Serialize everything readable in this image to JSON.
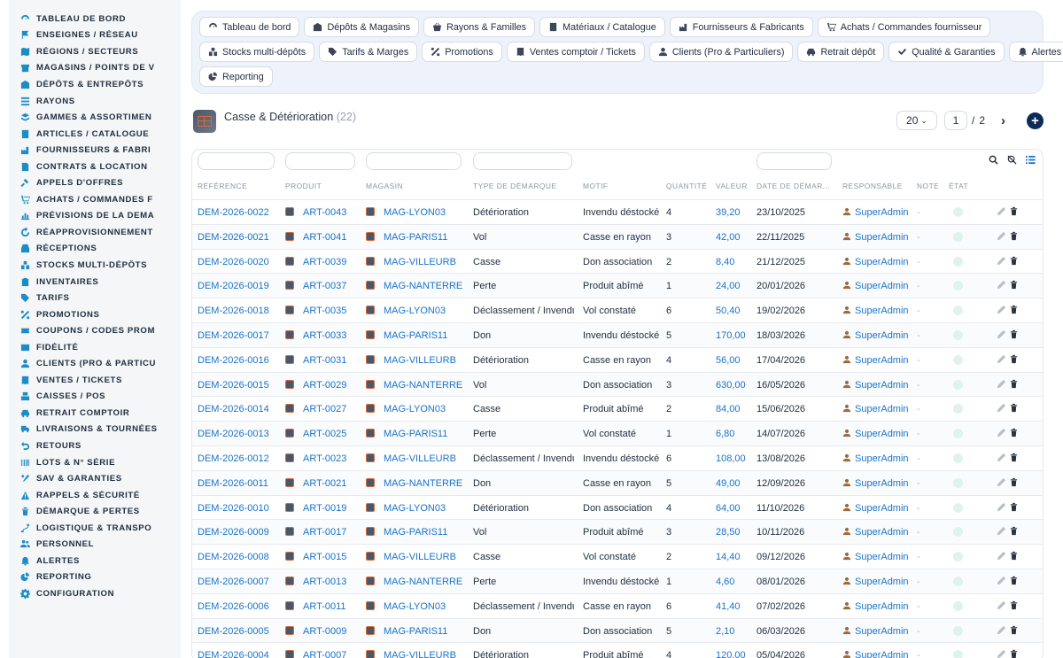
{
  "sidebar": {
    "items": [
      {
        "label": "TABLEAU DE BORD",
        "icon": "dashboard-icon"
      },
      {
        "label": "ENSEIGNES / RÉSEAU",
        "icon": "flag-icon"
      },
      {
        "label": "RÉGIONS / SECTEURS",
        "icon": "map-icon"
      },
      {
        "label": "MAGASINS / POINTS DE V",
        "icon": "store-icon"
      },
      {
        "label": "DÉPÔTS & ENTREPÔTS",
        "icon": "warehouse-icon"
      },
      {
        "label": "RAYONS",
        "icon": "shelf-icon"
      },
      {
        "label": "GAMMES & ASSORTIMEN",
        "icon": "layers-icon"
      },
      {
        "label": "ARTICLES / CATALOGUE",
        "icon": "catalog-icon"
      },
      {
        "label": "FOURNISSEURS & FABRI",
        "icon": "factory-icon"
      },
      {
        "label": "CONTRATS & LOCATION",
        "icon": "document-icon"
      },
      {
        "label": "APPELS D'OFFRES",
        "icon": "gavel-icon"
      },
      {
        "label": "ACHATS / COMMANDES F",
        "icon": "cart-icon"
      },
      {
        "label": "PRÉVISIONS DE LA DEMA",
        "icon": "chart-icon"
      },
      {
        "label": "RÉAPPROVISIONNEMENT",
        "icon": "refresh-icon"
      },
      {
        "label": "RÉCEPTIONS",
        "icon": "inbox-icon"
      },
      {
        "label": "STOCKS MULTI-DÉPÔTS",
        "icon": "boxes-icon"
      },
      {
        "label": "INVENTAIRES",
        "icon": "clipboard-icon"
      },
      {
        "label": "TARIFS",
        "icon": "tag-icon"
      },
      {
        "label": "PROMOTIONS",
        "icon": "percent-icon"
      },
      {
        "label": "COUPONS / CODES PROM",
        "icon": "ticket-icon"
      },
      {
        "label": "FIDÉLITÉ",
        "icon": "card-icon"
      },
      {
        "label": "CLIENTS (PRO & PARTICU",
        "icon": "user-icon"
      },
      {
        "label": "VENTES / TICKETS",
        "icon": "receipt-icon"
      },
      {
        "label": "CAISSES / POS",
        "icon": "register-icon"
      },
      {
        "label": "RETRAIT COMPTOIR",
        "icon": "car-icon"
      },
      {
        "label": "LIVRAISONS & TOURNÉES",
        "icon": "truck-icon"
      },
      {
        "label": "RETOURS",
        "icon": "undo-icon"
      },
      {
        "label": "LOTS & N° SÉRIE",
        "icon": "barcode-icon"
      },
      {
        "label": "SAV & GARANTIES",
        "icon": "tools-icon"
      },
      {
        "label": "RAPPELS & SÉCURITÉ",
        "icon": "warning-icon"
      },
      {
        "label": "DÉMARQUE & PERTES",
        "icon": "trash-icon"
      },
      {
        "label": "LOGISTIQUE & TRANSPO",
        "icon": "route-icon"
      },
      {
        "label": "PERSONNEL",
        "icon": "people-icon"
      },
      {
        "label": "ALERTES",
        "icon": "bell-icon"
      },
      {
        "label": "REPORTING",
        "icon": "pie-icon"
      },
      {
        "label": "CONFIGURATION",
        "icon": "gear-icon"
      }
    ]
  },
  "modules": {
    "rows": [
      [
        {
          "label": "Tableau de bord",
          "icon": "dashboard-icon"
        },
        {
          "label": "Dépôts & Magasins",
          "icon": "warehouse-icon"
        },
        {
          "label": "Rayons & Familles",
          "icon": "basket-icon"
        },
        {
          "label": "Matériaux / Catalogue",
          "icon": "catalog-icon"
        },
        {
          "label": "Fournisseurs & Fabricants",
          "icon": "factory-icon"
        },
        {
          "label": "Achats / Commandes fournisseur",
          "icon": "cart-icon"
        }
      ],
      [
        {
          "label": "Stocks multi-dépôts",
          "icon": "boxes-icon"
        },
        {
          "label": "Tarifs & Marges",
          "icon": "tag-icon"
        },
        {
          "label": "Promotions",
          "icon": "percent-icon"
        },
        {
          "label": "Ventes comptoir / Tickets",
          "icon": "receipt-icon"
        },
        {
          "label": "Clients (Pro & Particuliers)",
          "icon": "user-icon"
        },
        {
          "label": "Retrait dépôt",
          "icon": "car-icon"
        },
        {
          "label": "Qualité & Garanties",
          "icon": "check-icon"
        },
        {
          "label": "Alertes",
          "icon": "bell-icon"
        }
      ],
      [
        {
          "label": "Reporting",
          "icon": "pie-icon"
        }
      ]
    ]
  },
  "header": {
    "title": "Casse & Détérioration",
    "count": "(22)",
    "page_size": "20",
    "page_current": "1",
    "page_separator": "/",
    "page_total": "2",
    "next_symbol": "›",
    "add_symbol": "+"
  },
  "table": {
    "columns": [
      "RÉFÉRENCE",
      "PRODUIT",
      "MAGASIN",
      "TYPE DE DÉMARQUE",
      "MOTIF",
      "QUANTITÉ",
      "VALEUR",
      "DATE DE DÉMAR...",
      "RESPONSABLE",
      "NOTE",
      "ÉTAT"
    ],
    "rows": [
      [
        "DEM-2026-0022",
        "ART-0043",
        "MAG-LYON03",
        "Détérioration",
        "Invendu déstocké",
        "4",
        "39,20",
        "23/10/2025",
        "SuperAdmin",
        "-"
      ],
      [
        "DEM-2026-0021",
        "ART-0041",
        "MAG-PARIS11",
        "Vol",
        "Casse en rayon",
        "3",
        "42,00",
        "22/11/2025",
        "SuperAdmin",
        "-"
      ],
      [
        "DEM-2026-0020",
        "ART-0039",
        "MAG-VILLEURB",
        "Casse",
        "Don association",
        "2",
        "8,40",
        "21/12/2025",
        "SuperAdmin",
        "-"
      ],
      [
        "DEM-2026-0019",
        "ART-0037",
        "MAG-NANTERRE",
        "Perte",
        "Produit abîmé",
        "1",
        "24,00",
        "20/01/2026",
        "SuperAdmin",
        "-"
      ],
      [
        "DEM-2026-0018",
        "ART-0035",
        "MAG-LYON03",
        "Déclassement / Invendu",
        "Vol constaté",
        "6",
        "50,40",
        "19/02/2026",
        "SuperAdmin",
        "-"
      ],
      [
        "DEM-2026-0017",
        "ART-0033",
        "MAG-PARIS11",
        "Don",
        "Invendu déstocké",
        "5",
        "170,00",
        "18/03/2026",
        "SuperAdmin",
        "-"
      ],
      [
        "DEM-2026-0016",
        "ART-0031",
        "MAG-VILLEURB",
        "Détérioration",
        "Casse en rayon",
        "4",
        "56,00",
        "17/04/2026",
        "SuperAdmin",
        "-"
      ],
      [
        "DEM-2026-0015",
        "ART-0029",
        "MAG-NANTERRE",
        "Vol",
        "Don association",
        "3",
        "630,00",
        "16/05/2026",
        "SuperAdmin",
        "-"
      ],
      [
        "DEM-2026-0014",
        "ART-0027",
        "MAG-LYON03",
        "Casse",
        "Produit abîmé",
        "2",
        "84,00",
        "15/06/2026",
        "SuperAdmin",
        "-"
      ],
      [
        "DEM-2026-0013",
        "ART-0025",
        "MAG-PARIS11",
        "Perte",
        "Vol constaté",
        "1",
        "6,80",
        "14/07/2026",
        "SuperAdmin",
        "-"
      ],
      [
        "DEM-2026-0012",
        "ART-0023",
        "MAG-VILLEURB",
        "Déclassement / Invendu",
        "Invendu déstocké",
        "6",
        "108,00",
        "13/08/2026",
        "SuperAdmin",
        "-"
      ],
      [
        "DEM-2026-0011",
        "ART-0021",
        "MAG-NANTERRE",
        "Don",
        "Casse en rayon",
        "5",
        "49,00",
        "12/09/2026",
        "SuperAdmin",
        "-"
      ],
      [
        "DEM-2026-0010",
        "ART-0019",
        "MAG-LYON03",
        "Détérioration",
        "Don association",
        "4",
        "64,00",
        "11/10/2026",
        "SuperAdmin",
        "-"
      ],
      [
        "DEM-2026-0009",
        "ART-0017",
        "MAG-PARIS11",
        "Vol",
        "Produit abîmé",
        "3",
        "28,50",
        "10/11/2026",
        "SuperAdmin",
        "-"
      ],
      [
        "DEM-2026-0008",
        "ART-0015",
        "MAG-VILLEURB",
        "Casse",
        "Vol constaté",
        "2",
        "14,40",
        "09/12/2026",
        "SuperAdmin",
        "-"
      ],
      [
        "DEM-2026-0007",
        "ART-0013",
        "MAG-NANTERRE",
        "Perte",
        "Invendu déstocké",
        "1",
        "4,60",
        "08/01/2026",
        "SuperAdmin",
        "-"
      ],
      [
        "DEM-2026-0006",
        "ART-0011",
        "MAG-LYON03",
        "Déclassement / Invendu",
        "Casse en rayon",
        "6",
        "41,40",
        "07/02/2026",
        "SuperAdmin",
        "-"
      ],
      [
        "DEM-2026-0005",
        "ART-0009",
        "MAG-PARIS11",
        "Don",
        "Don association",
        "5",
        "2,10",
        "06/03/2026",
        "SuperAdmin",
        "-"
      ],
      [
        "DEM-2026-0004",
        "ART-0007",
        "MAG-VILLEURB",
        "Détérioration",
        "Produit abîmé",
        "4",
        "120,00",
        "05/04/2026",
        "SuperAdmin",
        "-"
      ]
    ]
  },
  "colors": {
    "accent": "#1d8cc4",
    "link": "#1a73c8",
    "primary_button": "#0e2a57",
    "state_dot": "#dff3ec",
    "user_icon": "#9a6b3e"
  }
}
